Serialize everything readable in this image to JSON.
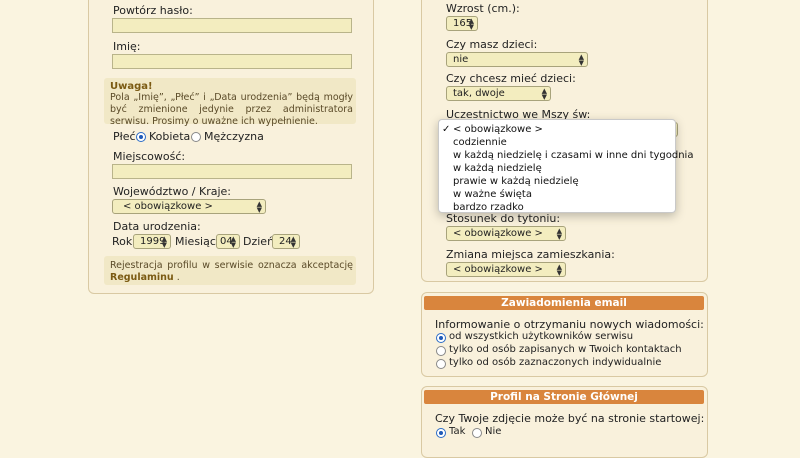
{
  "left_form": {
    "repeat_password_label": "Powtórz hasło:",
    "first_name_label": "Imię:",
    "notice_title": "Uwaga!",
    "notice_text": "Pola „Imię”, „Płeć” i „Data urodzenia” będą mogły być zmienione jedynie przez administratora serwisu. Prosimy o uważne ich wypełnienie.",
    "gender_label": "Płeć:",
    "gender_female": "Kobieta",
    "gender_male": "Mężczyzna",
    "city_label": "Miejscowość:",
    "region_label": "Województwo / Kraje:",
    "region_value": "< obowiązkowe >",
    "birthdate_label": "Data urodzenia:",
    "year_label": "Rok",
    "year_value": "1999",
    "month_label": "Miesiąc",
    "month_value": "04",
    "day_label": "Dzień",
    "day_value": "24",
    "terms_text": "Rejestracja profilu w serwisie oznacza akceptację",
    "terms_link": "Regulaminu",
    "terms_end": "."
  },
  "right_form": {
    "height_label": "Wzrost (cm.):",
    "height_value": "165",
    "have_children_label": "Czy masz dzieci:",
    "have_children_value": "nie",
    "want_children_label": "Czy chcesz mieć dzieci:",
    "want_children_value": "tak, dwoje",
    "mass_label": "Uczestnictwo we Mszy św:",
    "mass_options": [
      "< obowiązkowe >",
      "codziennie",
      "w każdą niedzielę i czasami w inne dni tygodnia",
      "w każdą niedzielę",
      "prawie w każdą niedzielę",
      "w ważne święta",
      "bardzo rzadko"
    ],
    "mass_selected_index": 0,
    "checkmark": "✓",
    "tobacco_label": "Stosunek do tytoniu:",
    "tobacco_value": "< obowiązkowe >",
    "relocation_label": "Zmiana miejsca zamieszkania:",
    "relocation_value": "< obowiązkowe >"
  },
  "email_section": {
    "title": "Zawiadomienia email",
    "question": "Informowanie o otrzymaniu nowych wiadomości:",
    "options": [
      "od wszystkich użytkowników serwisu",
      "tylko od osób zapisanych w Twoich kontaktach",
      "tylko od osób zaznaczonych indywidualnie"
    ],
    "selected_index": 0
  },
  "homepage_section": {
    "title": "Profil na Stronie Głównej",
    "question": "Czy Twoje zdjęcie może być na stronie startowej:",
    "yes_label": "Tak",
    "no_label": "Nie",
    "selected": "yes"
  },
  "icons": {
    "select_arrows": "select-arrows-icon",
    "checkmark": "checkmark-icon"
  },
  "colors": {
    "background": "#faf4e0",
    "input_fill": "#f3edbf",
    "section_header": "#d9853d",
    "notice_title": "#7b5a12",
    "radio_selected": "#1f5ab8"
  }
}
